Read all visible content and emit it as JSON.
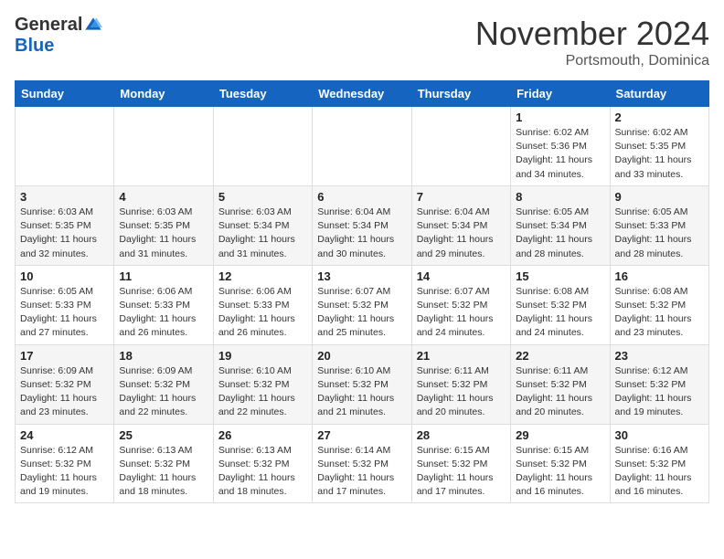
{
  "header": {
    "logo_general": "General",
    "logo_blue": "Blue",
    "month_title": "November 2024",
    "location": "Portsmouth, Dominica"
  },
  "days_of_week": [
    "Sunday",
    "Monday",
    "Tuesday",
    "Wednesday",
    "Thursday",
    "Friday",
    "Saturday"
  ],
  "weeks": [
    [
      {
        "day": "",
        "detail": ""
      },
      {
        "day": "",
        "detail": ""
      },
      {
        "day": "",
        "detail": ""
      },
      {
        "day": "",
        "detail": ""
      },
      {
        "day": "",
        "detail": ""
      },
      {
        "day": "1",
        "detail": "Sunrise: 6:02 AM\nSunset: 5:36 PM\nDaylight: 11 hours\nand 34 minutes."
      },
      {
        "day": "2",
        "detail": "Sunrise: 6:02 AM\nSunset: 5:35 PM\nDaylight: 11 hours\nand 33 minutes."
      }
    ],
    [
      {
        "day": "3",
        "detail": "Sunrise: 6:03 AM\nSunset: 5:35 PM\nDaylight: 11 hours\nand 32 minutes."
      },
      {
        "day": "4",
        "detail": "Sunrise: 6:03 AM\nSunset: 5:35 PM\nDaylight: 11 hours\nand 31 minutes."
      },
      {
        "day": "5",
        "detail": "Sunrise: 6:03 AM\nSunset: 5:34 PM\nDaylight: 11 hours\nand 31 minutes."
      },
      {
        "day": "6",
        "detail": "Sunrise: 6:04 AM\nSunset: 5:34 PM\nDaylight: 11 hours\nand 30 minutes."
      },
      {
        "day": "7",
        "detail": "Sunrise: 6:04 AM\nSunset: 5:34 PM\nDaylight: 11 hours\nand 29 minutes."
      },
      {
        "day": "8",
        "detail": "Sunrise: 6:05 AM\nSunset: 5:34 PM\nDaylight: 11 hours\nand 28 minutes."
      },
      {
        "day": "9",
        "detail": "Sunrise: 6:05 AM\nSunset: 5:33 PM\nDaylight: 11 hours\nand 28 minutes."
      }
    ],
    [
      {
        "day": "10",
        "detail": "Sunrise: 6:05 AM\nSunset: 5:33 PM\nDaylight: 11 hours\nand 27 minutes."
      },
      {
        "day": "11",
        "detail": "Sunrise: 6:06 AM\nSunset: 5:33 PM\nDaylight: 11 hours\nand 26 minutes."
      },
      {
        "day": "12",
        "detail": "Sunrise: 6:06 AM\nSunset: 5:33 PM\nDaylight: 11 hours\nand 26 minutes."
      },
      {
        "day": "13",
        "detail": "Sunrise: 6:07 AM\nSunset: 5:32 PM\nDaylight: 11 hours\nand 25 minutes."
      },
      {
        "day": "14",
        "detail": "Sunrise: 6:07 AM\nSunset: 5:32 PM\nDaylight: 11 hours\nand 24 minutes."
      },
      {
        "day": "15",
        "detail": "Sunrise: 6:08 AM\nSunset: 5:32 PM\nDaylight: 11 hours\nand 24 minutes."
      },
      {
        "day": "16",
        "detail": "Sunrise: 6:08 AM\nSunset: 5:32 PM\nDaylight: 11 hours\nand 23 minutes."
      }
    ],
    [
      {
        "day": "17",
        "detail": "Sunrise: 6:09 AM\nSunset: 5:32 PM\nDaylight: 11 hours\nand 23 minutes."
      },
      {
        "day": "18",
        "detail": "Sunrise: 6:09 AM\nSunset: 5:32 PM\nDaylight: 11 hours\nand 22 minutes."
      },
      {
        "day": "19",
        "detail": "Sunrise: 6:10 AM\nSunset: 5:32 PM\nDaylight: 11 hours\nand 22 minutes."
      },
      {
        "day": "20",
        "detail": "Sunrise: 6:10 AM\nSunset: 5:32 PM\nDaylight: 11 hours\nand 21 minutes."
      },
      {
        "day": "21",
        "detail": "Sunrise: 6:11 AM\nSunset: 5:32 PM\nDaylight: 11 hours\nand 20 minutes."
      },
      {
        "day": "22",
        "detail": "Sunrise: 6:11 AM\nSunset: 5:32 PM\nDaylight: 11 hours\nand 20 minutes."
      },
      {
        "day": "23",
        "detail": "Sunrise: 6:12 AM\nSunset: 5:32 PM\nDaylight: 11 hours\nand 19 minutes."
      }
    ],
    [
      {
        "day": "24",
        "detail": "Sunrise: 6:12 AM\nSunset: 5:32 PM\nDaylight: 11 hours\nand 19 minutes."
      },
      {
        "day": "25",
        "detail": "Sunrise: 6:13 AM\nSunset: 5:32 PM\nDaylight: 11 hours\nand 18 minutes."
      },
      {
        "day": "26",
        "detail": "Sunrise: 6:13 AM\nSunset: 5:32 PM\nDaylight: 11 hours\nand 18 minutes."
      },
      {
        "day": "27",
        "detail": "Sunrise: 6:14 AM\nSunset: 5:32 PM\nDaylight: 11 hours\nand 17 minutes."
      },
      {
        "day": "28",
        "detail": "Sunrise: 6:15 AM\nSunset: 5:32 PM\nDaylight: 11 hours\nand 17 minutes."
      },
      {
        "day": "29",
        "detail": "Sunrise: 6:15 AM\nSunset: 5:32 PM\nDaylight: 11 hours\nand 16 minutes."
      },
      {
        "day": "30",
        "detail": "Sunrise: 6:16 AM\nSunset: 5:32 PM\nDaylight: 11 hours\nand 16 minutes."
      }
    ]
  ]
}
